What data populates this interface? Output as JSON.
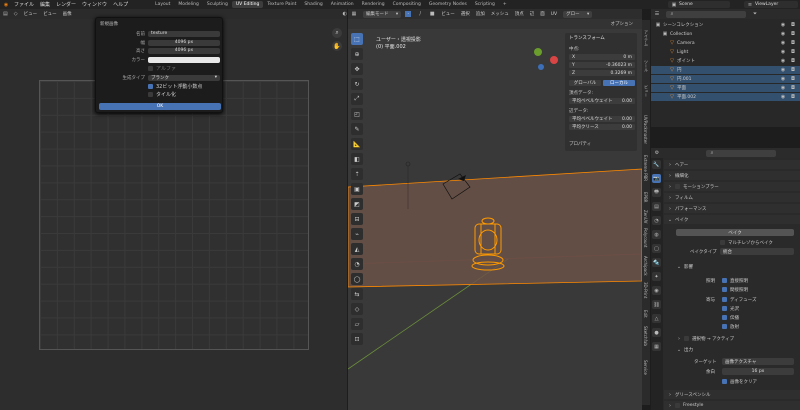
{
  "topbar": {
    "menus": [
      "ファイル",
      "編集",
      "レンダー",
      "ウィンドウ",
      "ヘルプ"
    ],
    "workspaces": [
      "Layout",
      "Modeling",
      "Sculpting",
      "UV Editing",
      "Texture Paint",
      "Shading",
      "Animation",
      "Rendering",
      "Compositing",
      "Geometry Nodes",
      "Scripting"
    ],
    "active_workspace": "UV Editing",
    "add_tab": "+",
    "scene": "Scene",
    "view_layer": "ViewLayer"
  },
  "uv_header": {
    "view": "ビュー",
    "view2": "ビュー",
    "image": "画像"
  },
  "new_image_dialog": {
    "title": "新規画像",
    "name_label": "名前",
    "name_value": "texture",
    "width_label": "幅",
    "width_value": "4096 px",
    "height_label": "高さ",
    "height_value": "4096 px",
    "color_label": "カラー",
    "alpha_label": "アルファ",
    "gen_type_label": "生成タイプ",
    "gen_type_value": "ブランク",
    "float_label": "32ビット浮動小数点",
    "tiled_label": "タイル化",
    "ok_label": "OK"
  },
  "view3d_header": {
    "mode": "編集モード",
    "menus": [
      "ビュー",
      "選択",
      "追加",
      "メッシュ",
      "頂点",
      "辺",
      "面",
      "UV"
    ],
    "orientation": "グロー",
    "options": "オプション"
  },
  "viewport_label": {
    "line1": "ユーザー・透視投影",
    "line2": "(0) 平面.002"
  },
  "n_panel": {
    "transform_title": "トランスフォーム",
    "median": "中点:",
    "x_label": "X",
    "x_value": "0 m",
    "y_label": "Y",
    "y_value": "-0.36023 m",
    "z_label": "Z",
    "z_value": "0.3269 m",
    "global": "グローバル",
    "local": "ローカル",
    "vertex_data": "頂点データ:",
    "mean_bevel_weight": "平均ベベルウェイト",
    "mean_bevel_value": "0.00",
    "edge_data": "辺データ:",
    "mean_bevel_weight2": "平均ベベルウェイト",
    "mean_bevel_value2": "0.00",
    "mean_crease": "平均クリース",
    "mean_crease_value": "0.00",
    "properties": "プロパティ"
  },
  "side_tabs": [
    "アイテム",
    "ツール",
    "ビュー",
    "UVPackmaster",
    "Extreme PBR",
    "EPBR",
    "ZenUV",
    "Polycount",
    "Archipack",
    "3D-Print",
    "Edit",
    "Sketchfab",
    "Service"
  ],
  "outliner": {
    "title": "シーンコレクション",
    "rows": [
      {
        "label": "シーンコレクション",
        "selected": false,
        "indent": 0
      },
      {
        "label": "Collection",
        "selected": false,
        "indent": 1
      },
      {
        "label": "Camera",
        "selected": false,
        "indent": 2
      },
      {
        "label": "Light",
        "selected": false,
        "indent": 2
      },
      {
        "label": "ポイント",
        "selected": false,
        "indent": 2
      },
      {
        "label": "円",
        "selected": true,
        "indent": 2
      },
      {
        "label": "円.001",
        "selected": true,
        "indent": 2
      },
      {
        "label": "平面",
        "selected": true,
        "indent": 2
      },
      {
        "label": "平面.002",
        "selected": true,
        "indent": 2
      }
    ]
  },
  "properties": {
    "sections": {
      "hair": "ヘアー",
      "sampling": "線細化",
      "motion_blur": "モーションブラー",
      "film": "フィルム",
      "performance": "パフォーマンス",
      "bake": "ベイク"
    },
    "bake_button": "ベイク",
    "multires": "マルチレゾからベイク",
    "bake_type_label": "ベイクタイプ",
    "bake_type_value": "統合",
    "influence": "影響",
    "lighting_label": "照明",
    "direct": "直接照明",
    "indirect": "間接照明",
    "contrib_label": "寄与",
    "diffuse": "ディフューズ",
    "gloss": "光沢",
    "transmission": "伝播",
    "emit": "放射",
    "selected_to_active": "選択物 → アクティブ",
    "output": "出力",
    "target_label": "ターゲット",
    "target_value": "画像テクスチャ",
    "margin_label": "余白",
    "margin_value": "16 px",
    "clear_image": "画像をクリア",
    "grease_pencil": "グリースペンシル",
    "freestyle": "Freestyle"
  },
  "colors": {
    "accent": "#4772b3",
    "selection": "#ff8a00",
    "outliner_sel": "#33506e"
  }
}
